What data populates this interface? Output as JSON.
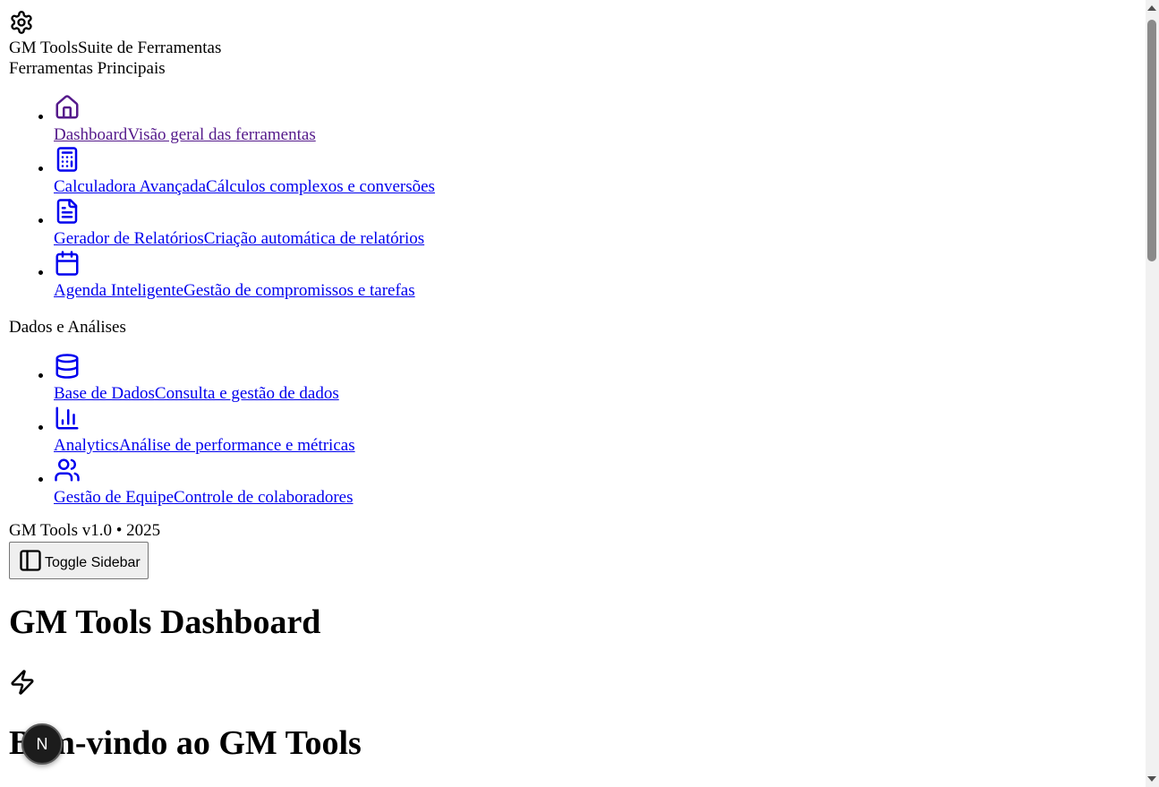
{
  "sidebar": {
    "logo_icon": "gear-icon",
    "brand_name": "GM Tools",
    "brand_subtitle": "Suite de Ferramentas",
    "groups": [
      {
        "title": "Ferramentas Principais",
        "items": [
          {
            "icon": "home-icon",
            "title": "Dashboard",
            "description": "Visão geral das ferramentas",
            "visited": true
          },
          {
            "icon": "calculator-icon",
            "title": "Calculadora Avançada",
            "description": "Cálculos complexos e conversões"
          },
          {
            "icon": "file-text-icon",
            "title": "Gerador de Relatórios",
            "description": "Criação automática de relatórios"
          },
          {
            "icon": "calendar-icon",
            "title": "Agenda Inteligente",
            "description": "Gestão de compromissos e tarefas"
          }
        ]
      },
      {
        "title": "Dados e Análises",
        "items": [
          {
            "icon": "database-icon",
            "title": "Base de Dados",
            "description": "Consulta e gestão de dados"
          },
          {
            "icon": "bar-chart-icon",
            "title": "Analytics",
            "description": "Análise de performance e métricas"
          },
          {
            "icon": "users-icon",
            "title": "Gestão de Equipe",
            "description": "Controle de colaboradores"
          }
        ]
      }
    ],
    "footer": "GM Tools v1.0 • 2025"
  },
  "header": {
    "toggle_icon": "panel-left-icon",
    "toggle_label": "Toggle Sidebar",
    "title": "GM Tools Dashboard"
  },
  "main": {
    "hero_icon": "zap-icon",
    "welcome_title": "Bem-vindo ao GM Tools"
  },
  "dev_badge": {
    "label": "N"
  },
  "colors": {
    "link": "#0000ee",
    "visited": "#551a8b"
  }
}
